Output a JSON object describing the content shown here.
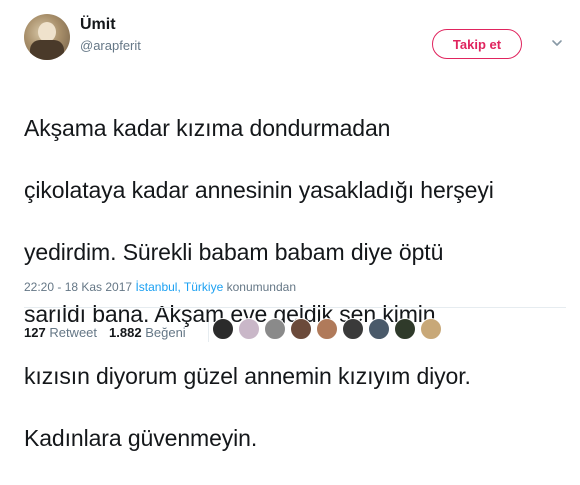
{
  "user": {
    "name": "Ümit",
    "handle": "@arapferit"
  },
  "follow_button": {
    "label": "Takip et"
  },
  "tweet": {
    "text_lines": [
      "Akşama kadar kızıma dondurmadan",
      "çikolataya kadar annesinin yasakladığı herşeyi",
      "yedirdim. Sürekli babam babam diye öptü",
      "sarıldı bana. Akşam eve geldik sen kimin",
      "kızısın diyorum güzel annemin kızıyım diyor.",
      "Kadınlara güvenmeyin."
    ]
  },
  "meta": {
    "time": "22:20 - 18 Kas 2017",
    "location": "İstanbul, Türkiye",
    "location_suffix": "konumundan"
  },
  "stats": {
    "retweet_count": "127",
    "retweet_label": "Retweet",
    "like_count": "1.882",
    "like_label": "Beğeni"
  },
  "likers": [
    {
      "color": "#2b2b2b"
    },
    {
      "color": "#c9b7c8"
    },
    {
      "color": "#8a8a8a"
    },
    {
      "color": "#6b4a3a"
    },
    {
      "color": "#b07a5a"
    },
    {
      "color": "#3a3a3a"
    },
    {
      "color": "#4a5a6a"
    },
    {
      "color": "#2f3a2a"
    },
    {
      "color": "#c8a878"
    }
  ],
  "colors": {
    "accent": "#e0245e",
    "link": "#1da1f2",
    "muted": "#657786"
  }
}
